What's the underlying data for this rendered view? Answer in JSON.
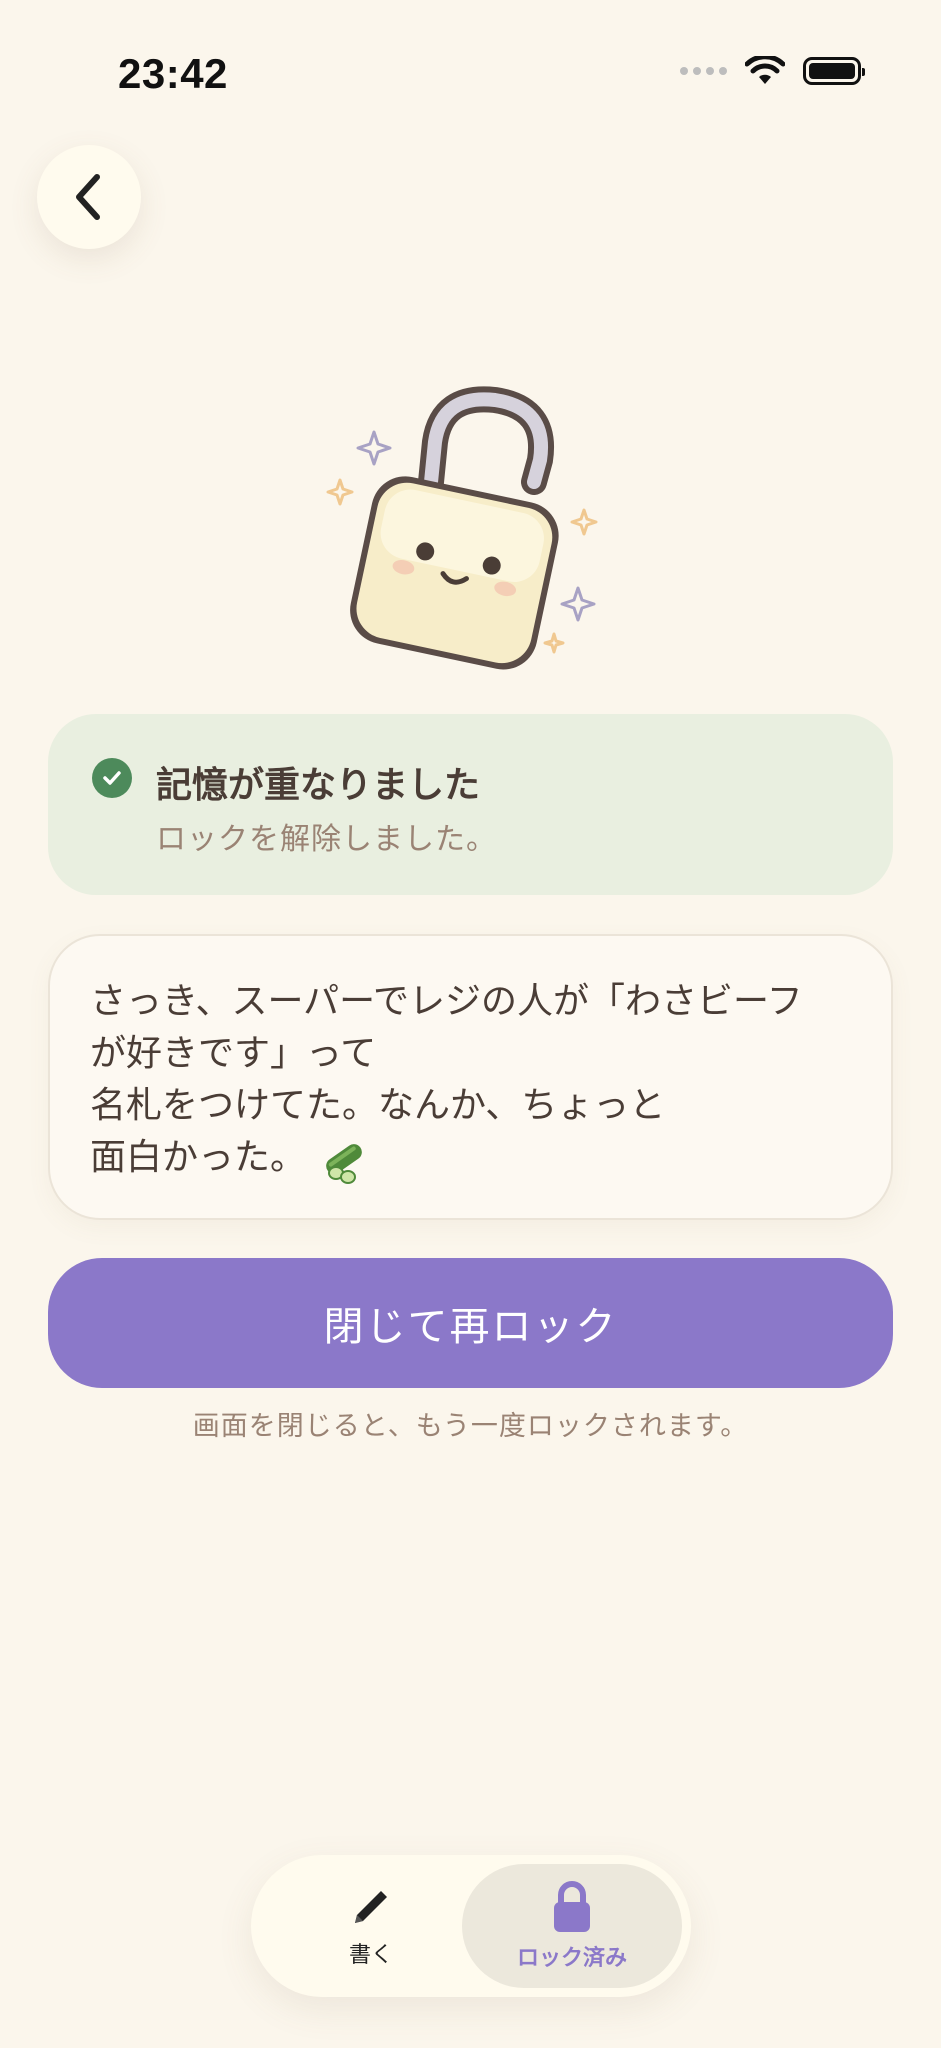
{
  "status_bar": {
    "time": "23:42"
  },
  "header": {
    "back_icon": "chevron-left-icon"
  },
  "success": {
    "title": "記憶が重なりました",
    "subtitle": "ロックを解除しました。",
    "icon": "check-circle-icon"
  },
  "message": {
    "text": "さっき、スーパーでレジの人が「わさビーフ\nが好きです」って\n名札をつけてた。なんか、ちょっと\n面白かった。",
    "emoji_icon": "cucumber-icon"
  },
  "actions": {
    "relock_label": "閉じて再ロック",
    "relock_hint": "画面を閉じると、もう一度ロックされます。"
  },
  "tab_bar": {
    "tabs": [
      {
        "label": "書く",
        "icon": "pencil-icon"
      },
      {
        "label": "ロック済み",
        "icon": "lock-icon"
      }
    ],
    "active_color": "#8b78c9"
  },
  "colors": {
    "background": "#fbf6ec",
    "success_bg": "#e9efe0",
    "check": "#4d8a5b",
    "accent": "#8b78c9"
  }
}
